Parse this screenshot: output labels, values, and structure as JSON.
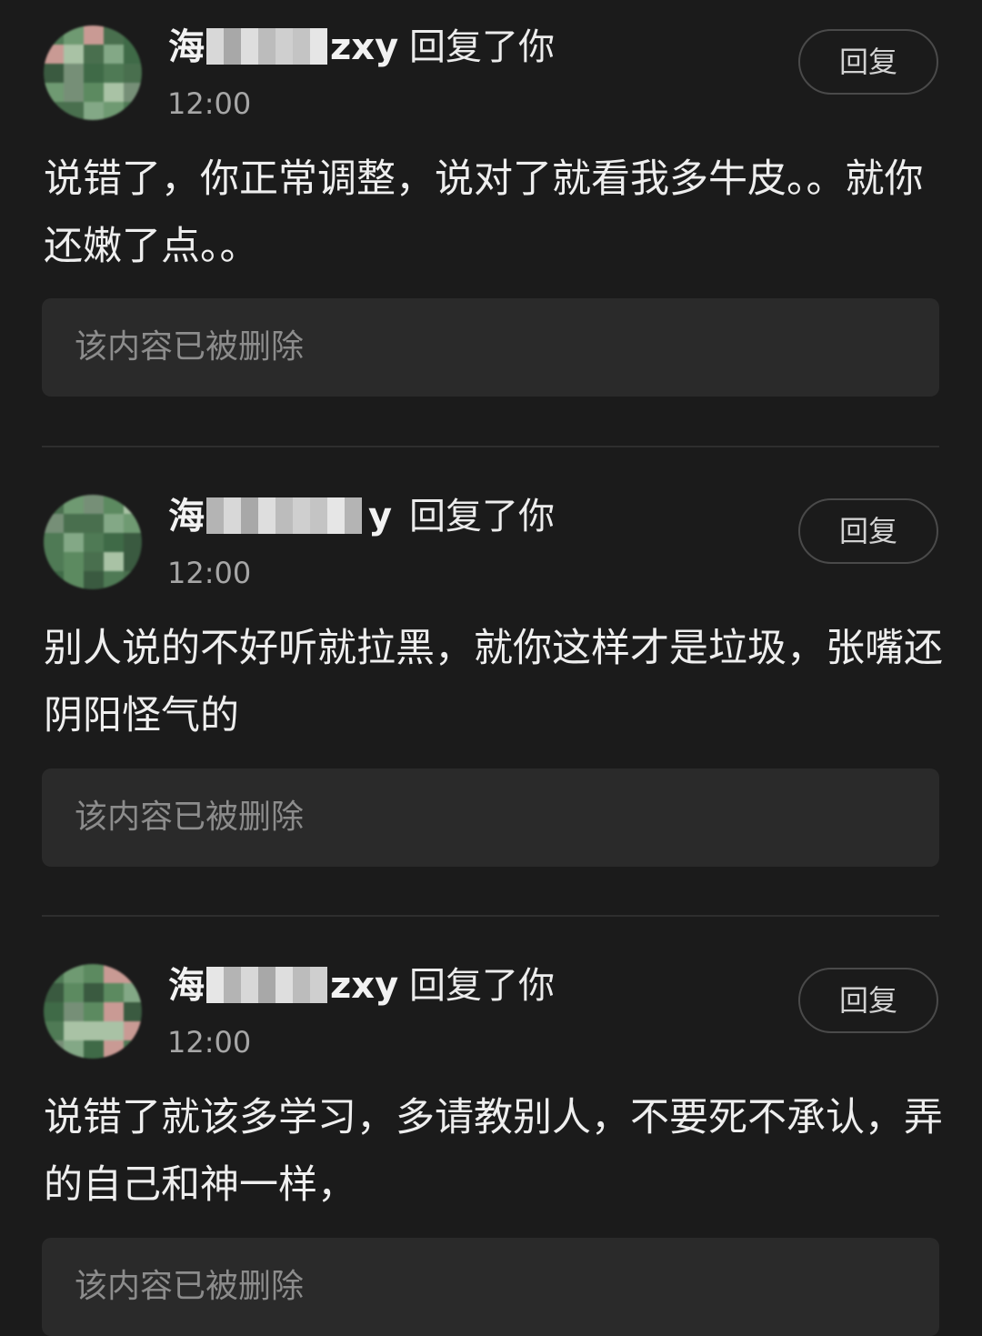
{
  "comments": [
    {
      "user_prefix": "海",
      "user_suffix": "zxy",
      "action": "回复了你",
      "time": "12:00",
      "reply_label": "回复",
      "text": "说错了，你正常调整，说对了就看我多牛皮。。就你还嫩了点。。",
      "deleted_notice": "该内容已被删除"
    },
    {
      "user_prefix": "海",
      "user_suffix": "y",
      "action": "回复了你",
      "time": "12:00",
      "reply_label": "回复",
      "text": "别人说的不好听就拉黑，就你这样才是垃圾，张嘴还阴阳怪气的",
      "deleted_notice": "该内容已被删除"
    },
    {
      "user_prefix": "海",
      "user_suffix": "zxy",
      "action": "回复了你",
      "time": "12:00",
      "reply_label": "回复",
      "text": "说错了就该多学习，多请教别人，不要死不承认，弄的自己和神一样，",
      "deleted_notice": "该内容已被删除"
    }
  ],
  "colors": {
    "background": "#1b1b1b",
    "deleted_box": "#2a2a2a",
    "button_border": "#4a4a4a",
    "avatar_green": "#4f7a55"
  }
}
